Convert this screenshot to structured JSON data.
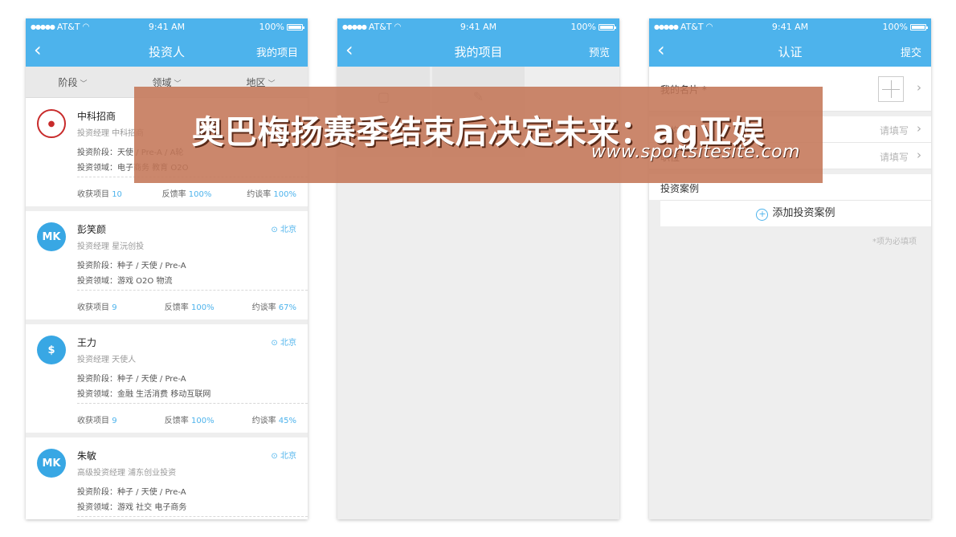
{
  "status": {
    "carrier": "AT&T",
    "time": "9:41 AM",
    "battery": "100%",
    "battery_level": 1.0
  },
  "phone1": {
    "title": "投资人",
    "action": "我的项目",
    "filters": [
      "阶段",
      "领域",
      "地区"
    ],
    "investors": [
      {
        "name": "中科招商",
        "role": "投资经理 中科招商",
        "location": "",
        "stage": "投资阶段：天使 / Pre-A / A轮",
        "field": "投资领域：电子商务 教育 O2O",
        "projects_label": "收获项目",
        "projects": "10",
        "feedback_label": "反馈率",
        "feedback": "100%",
        "meet_label": "约谈率",
        "meet": "100%",
        "avatar": "seal"
      },
      {
        "name": "彭笑颜",
        "role": "投资经理 星沅创投",
        "location": "北京",
        "stage": "投资阶段：种子 / 天使 / Pre-A",
        "field": "投资领域：游戏 O2O 物流",
        "projects_label": "收获项目",
        "projects": "9",
        "feedback_label": "反馈率",
        "feedback": "100%",
        "meet_label": "约谈率",
        "meet": "67%",
        "avatar": "MK"
      },
      {
        "name": "王力",
        "role": "投资经理 天使人",
        "location": "北京",
        "stage": "投资阶段：种子 / 天使 / Pre-A",
        "field": "投资领域：金融 生活消费 移动互联网",
        "projects_label": "收获项目",
        "projects": "9",
        "feedback_label": "反馈率",
        "feedback": "100%",
        "meet_label": "约谈率",
        "meet": "45%",
        "avatar": "$"
      },
      {
        "name": "朱敏",
        "role": "高级投资经理 浦东创业投资",
        "location": "北京",
        "stage": "投资阶段：种子 / 天使 / Pre-A",
        "field": "投资领域：游戏 社交 电子商务",
        "projects_label": "",
        "projects": "",
        "feedback_label": "",
        "feedback": "",
        "meet_label": "",
        "meet": "",
        "avatar": "MK"
      }
    ]
  },
  "phone2": {
    "title": "我的项目",
    "action": "预览"
  },
  "phone3": {
    "title": "认证",
    "action": "提交",
    "card_label": "我的名片 *",
    "row2_label": "机构",
    "row2_value": "请填写",
    "row3_label": "职位",
    "row3_value": "请填写",
    "case_label": "投资案例",
    "add_case": "添加投资案例",
    "note": "*项为必填项"
  },
  "banner": {
    "headline": "奥巴梅扬赛季结束后决定未来：ag亚娱",
    "url": "www.sportsitesite.com"
  },
  "colors": {
    "accent": "#4db3ec",
    "banner": "#c47658"
  }
}
